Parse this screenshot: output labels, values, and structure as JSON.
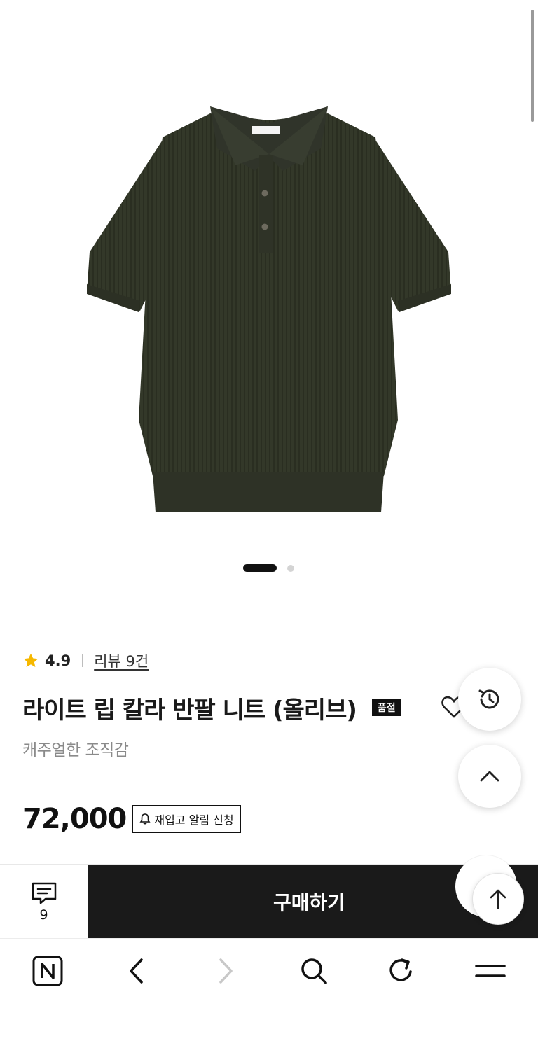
{
  "product": {
    "rating": "4.9",
    "review_link": "리뷰 9건",
    "title": "라이트 립 칼라 반팔 니트 (올리브)",
    "soldout_badge": "품절",
    "subtitle": "캐주얼한 조직감",
    "price": "72,000",
    "restock_button": "재입고 알림 신청",
    "shirt_color": "#333829",
    "image_count": 2,
    "current_image": 1
  },
  "action_bar": {
    "chat_count": "9",
    "buy_label": "구매하기"
  },
  "icons": {
    "star": "star-icon",
    "heart": "heart-icon",
    "share": "share-icon",
    "history": "history-icon",
    "scroll_up": "chevron-up-icon",
    "bell": "bell-icon",
    "chat": "chat-icon",
    "arrow_up": "arrow-up-icon"
  },
  "browser_toolbar": {
    "items": [
      "home-n-icon",
      "back-icon",
      "forward-icon",
      "search-icon",
      "refresh-icon",
      "menu-icon"
    ]
  },
  "colors": {
    "accent_star": "#f6b800",
    "buy_button": "#1a1a1a",
    "subtitle": "#8a8a8a"
  }
}
